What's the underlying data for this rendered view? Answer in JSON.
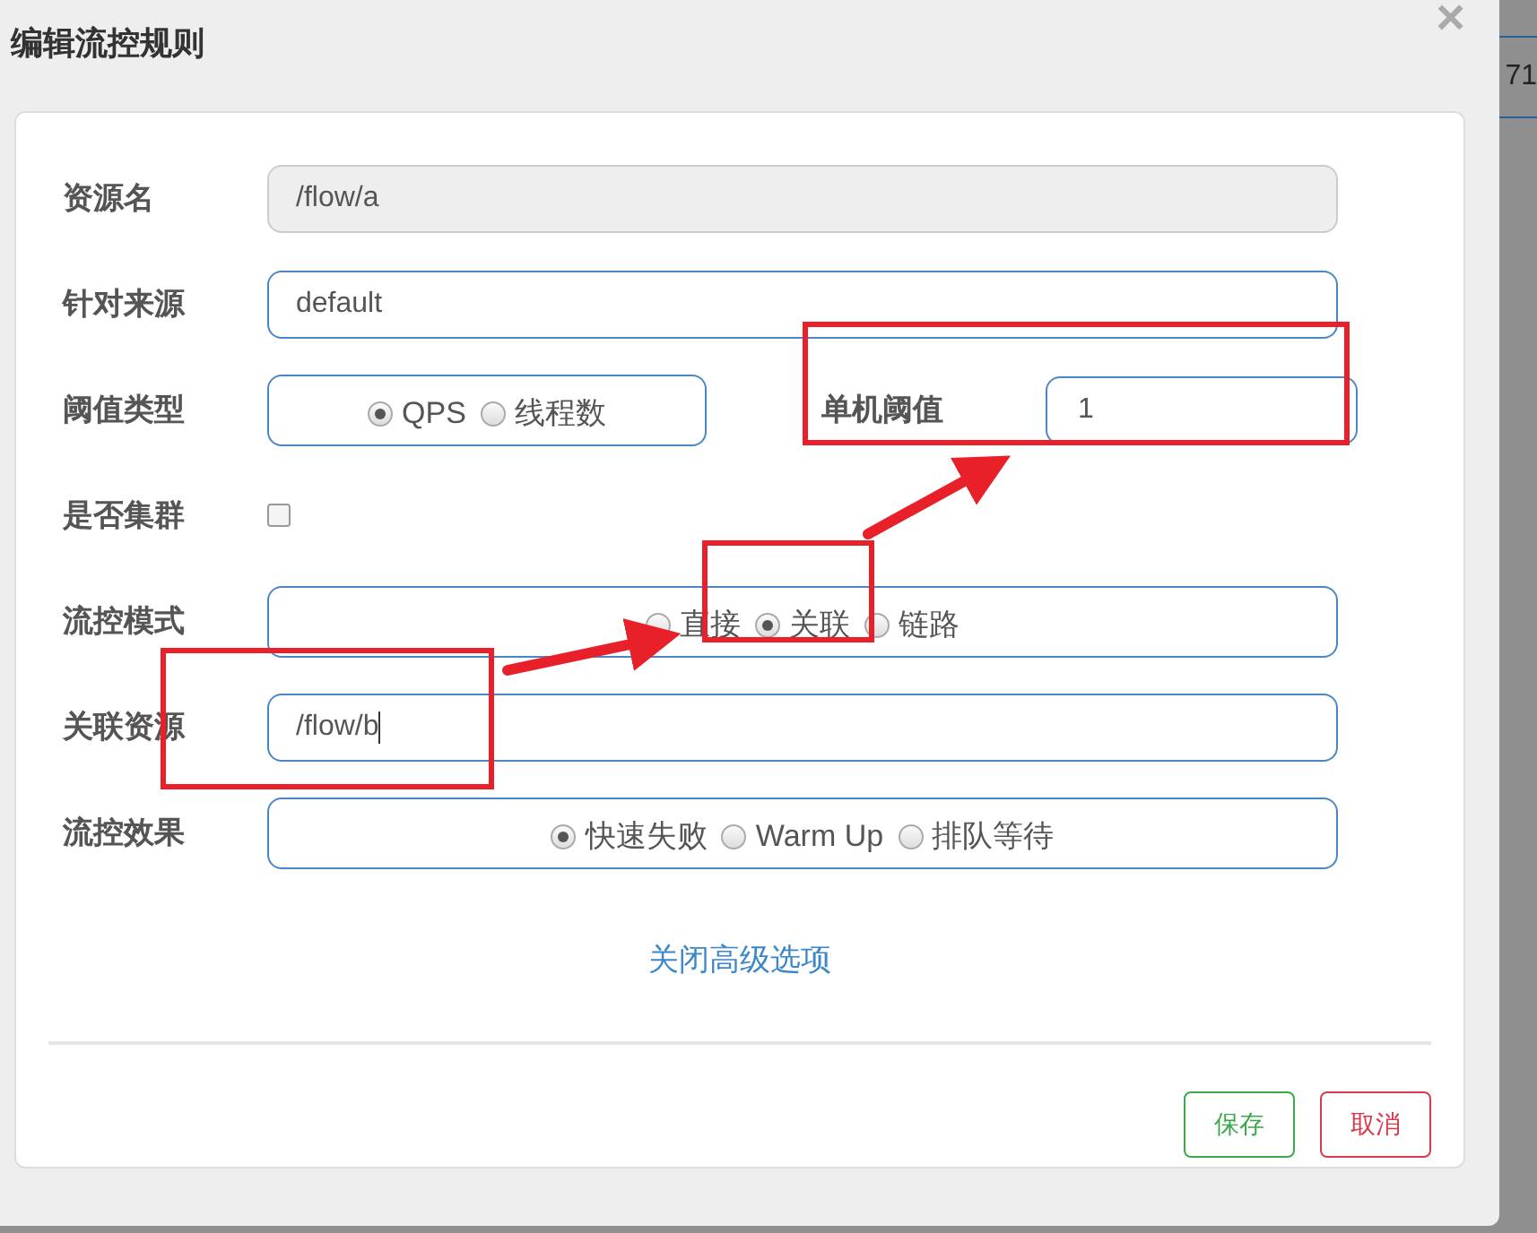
{
  "dialog": {
    "title": "编辑流控规则",
    "close": "×"
  },
  "background": {
    "cell_text": "71"
  },
  "rows": [
    {
      "kind": "input",
      "label": "资源名",
      "value": "/flow/a",
      "disabled": true
    },
    {
      "kind": "input",
      "label": "针对来源",
      "value": "default",
      "disabled": false
    },
    {
      "kind": "radio_input",
      "label": "阈值类型",
      "options": [
        {
          "label": "QPS",
          "selected": true
        },
        {
          "label": "线程数",
          "selected": false
        }
      ],
      "side_label": "单机阈值",
      "side_value": "1"
    },
    {
      "kind": "checkbox",
      "label": "是否集群",
      "checked": false
    },
    {
      "kind": "radio",
      "label": "流控模式",
      "options": [
        {
          "label": "直接",
          "selected": false
        },
        {
          "label": "关联",
          "selected": true
        },
        {
          "label": "链路",
          "selected": false
        }
      ]
    },
    {
      "kind": "input",
      "label": "关联资源",
      "value": "/flow/b",
      "disabled": false,
      "caret": true
    },
    {
      "kind": "radio",
      "label": "流控效果",
      "options": [
        {
          "label": "快速失败",
          "selected": true
        },
        {
          "label": "Warm Up",
          "selected": false
        },
        {
          "label": "排队等待",
          "selected": false
        }
      ]
    }
  ],
  "advanced_link": "关闭高级选项",
  "buttons": [
    {
      "label": "保存",
      "kind": "save"
    },
    {
      "label": "取消",
      "kind": "cancel"
    }
  ]
}
